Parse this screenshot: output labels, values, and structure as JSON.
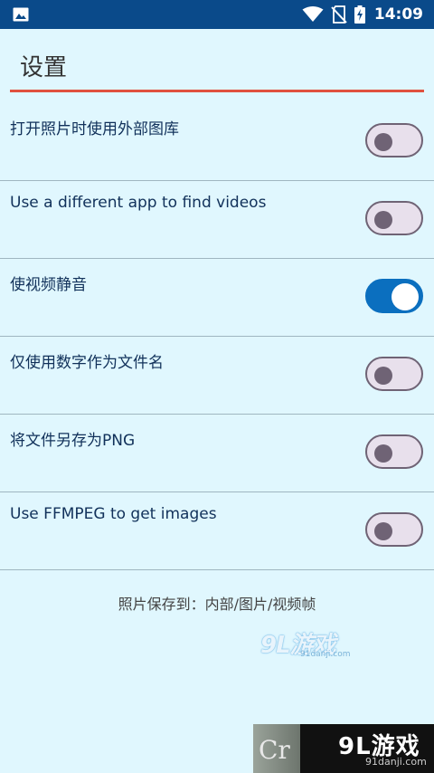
{
  "status_bar": {
    "time": "14:09",
    "icons": [
      "image-icon",
      "wifi-icon",
      "no-sim-icon",
      "battery-charging-icon"
    ],
    "color": "#0a4a8a"
  },
  "toolbar": {
    "title": "设置",
    "accent_color": "#e0513f"
  },
  "settings": [
    {
      "label": "打开照片时使用外部图库",
      "enabled": false
    },
    {
      "label": "Use a different app to find videos",
      "enabled": false
    },
    {
      "label": "使视频静音",
      "enabled": true
    },
    {
      "label": "仅使用数字作为文件名",
      "enabled": false
    },
    {
      "label": "将文件另存为PNG",
      "enabled": false
    },
    {
      "label": "Use FFMPEG to get images",
      "enabled": false
    }
  ],
  "save_location": "照片保存到：内部/图片/视频帧",
  "watermark": {
    "text": "9L游戏",
    "sub": "91danji.com"
  },
  "corner_logo": {
    "prefix": "Cr",
    "text": "9L游戏",
    "sub": "91danji.com"
  },
  "colors": {
    "background": "#e0f7fe",
    "switch_on": "#0b6fbf",
    "switch_off_track": "#e8e0ec",
    "switch_off_border": "#6f6375"
  }
}
